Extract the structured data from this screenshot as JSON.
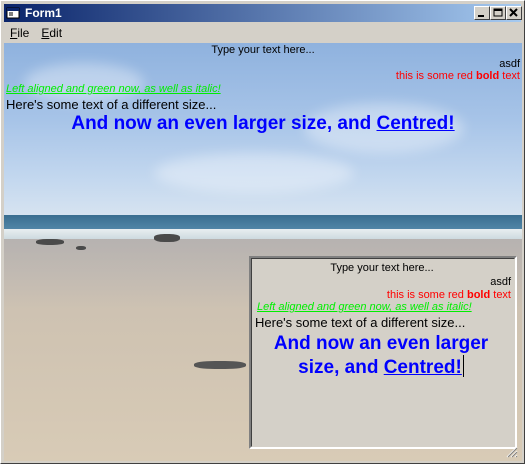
{
  "window": {
    "title": "Form1",
    "controls": {
      "minimize": "_",
      "maximize": "□",
      "close": "×"
    }
  },
  "menu": {
    "items": [
      {
        "label": "File",
        "accel": "F"
      },
      {
        "label": "Edit",
        "accel": "E"
      }
    ]
  },
  "background_text": {
    "line1": "Type your text here...",
    "line2": "asdf",
    "line3_pre": "this is some red ",
    "line3_bold": "bold",
    "line3_post": " text",
    "line4": "Left aligned and green now, as well as italic!",
    "line5": "Here's some text of a different size...",
    "line6_pre": "And now an even larger size, and ",
    "line6_link": "Centred!"
  },
  "rich_text_box": {
    "line1": "Type your text here...",
    "line2": "asdf",
    "line3_pre": "this is some red ",
    "line3_bold": "bold",
    "line3_post": " text",
    "line4": "Left aligned and green now, as well as italic!",
    "line5": "Here's some text of a different size...",
    "line6_pre": "And now an even larger size, and ",
    "line6_link": "Centred!"
  },
  "colors": {
    "titlebar_start": "#0a246a",
    "titlebar_end": "#a6caf0",
    "red_text": "#ff0000",
    "green_text": "#00ee00",
    "blue_text": "#0000ff",
    "window_face": "#d4d0c8"
  }
}
